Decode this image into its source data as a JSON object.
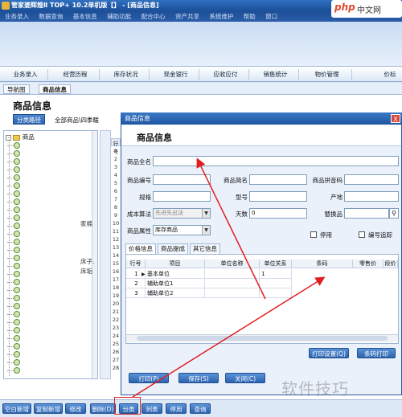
{
  "window": {
    "title": "管家婆辉煌Ⅱ  TOP+ 10.2单机版【】 - [商品信息]"
  },
  "menu": [
    "业务录入",
    "数据查询",
    "基本信息",
    "辅助功能",
    "配合中心",
    "资产共享",
    "系统维护",
    "帮助",
    "窗口"
  ],
  "modules": [
    "业务录入",
    "经营历程",
    "库存状况",
    "现金银行",
    "应收应付",
    "销售统计",
    "物价管理",
    "价标"
  ],
  "doc_tabs": [
    "导航图",
    "商品信息"
  ],
  "page": {
    "title": "商品信息",
    "path_button": "分类路径",
    "path_text": "全部商品\\四季暖",
    "tree_root": "商品",
    "row_header": "行号",
    "row_numbers": [
      "1",
      "2",
      "3",
      "4",
      "5",
      "6",
      "7",
      "8",
      "9",
      "10",
      "11",
      "12",
      "13",
      "14",
      "15",
      "16",
      "17",
      "18",
      "19",
      "20",
      "21",
      "22",
      "23",
      "24",
      "25",
      "26",
      "27",
      "28"
    ],
    "fragments": [
      "家棉",
      "床子.",
      "床垢"
    ]
  },
  "bottom_toolbar": [
    "空白新增",
    "复制新增",
    "修改",
    "删除(D)",
    "分类",
    "列表",
    "停用",
    "查询"
  ],
  "dialog": {
    "title": "商品信息",
    "heading": "商品信息",
    "close": "X",
    "fields": {
      "full_name": {
        "label": "商品全名",
        "value": ""
      },
      "code": {
        "label": "商品编号",
        "value": ""
      },
      "short_name": {
        "label": "商品简名",
        "value": ""
      },
      "pinyin": {
        "label": "商品拼音码",
        "value": ""
      },
      "spec": {
        "label": "规格",
        "value": ""
      },
      "model": {
        "label": "型号",
        "value": ""
      },
      "origin": {
        "label": "产地",
        "value": ""
      },
      "cost_method": {
        "label": "成本算法",
        "value": "先进先出法"
      },
      "days": {
        "label": "天数",
        "value": "0"
      },
      "substitute": {
        "label": "替换品",
        "value": ""
      },
      "property": {
        "label": "商品属性",
        "value": "库存商品"
      },
      "disabled": {
        "label": "停用"
      },
      "serial": {
        "label": "编号追踪"
      }
    },
    "sub_tabs": [
      "价格信息",
      "商品提成",
      "其它信息"
    ],
    "grid": {
      "columns": [
        "行号",
        "项目",
        "单位名称",
        "单位关系",
        "条码",
        "零售价",
        "段价"
      ],
      "rows": [
        {
          "no": "1",
          "item": "基本单位",
          "unit": "",
          "ratio": "1"
        },
        {
          "no": "2",
          "item": "辅助单位1",
          "unit": "",
          "ratio": ""
        },
        {
          "no": "3",
          "item": "辅助单位2",
          "unit": "",
          "ratio": ""
        }
      ]
    },
    "buttons": {
      "print_settings": "打印设置(Q)",
      "barcode_print": "条码打印",
      "print": "打印(P)",
      "save": "保存(S)",
      "close": "关闭(C)"
    }
  },
  "watermarks": {
    "top_brand": "php",
    "top_suffix": "中文网",
    "bottom": "软件技巧"
  },
  "colors": {
    "accent": "#2c63ae",
    "annotation": "#e02020"
  }
}
